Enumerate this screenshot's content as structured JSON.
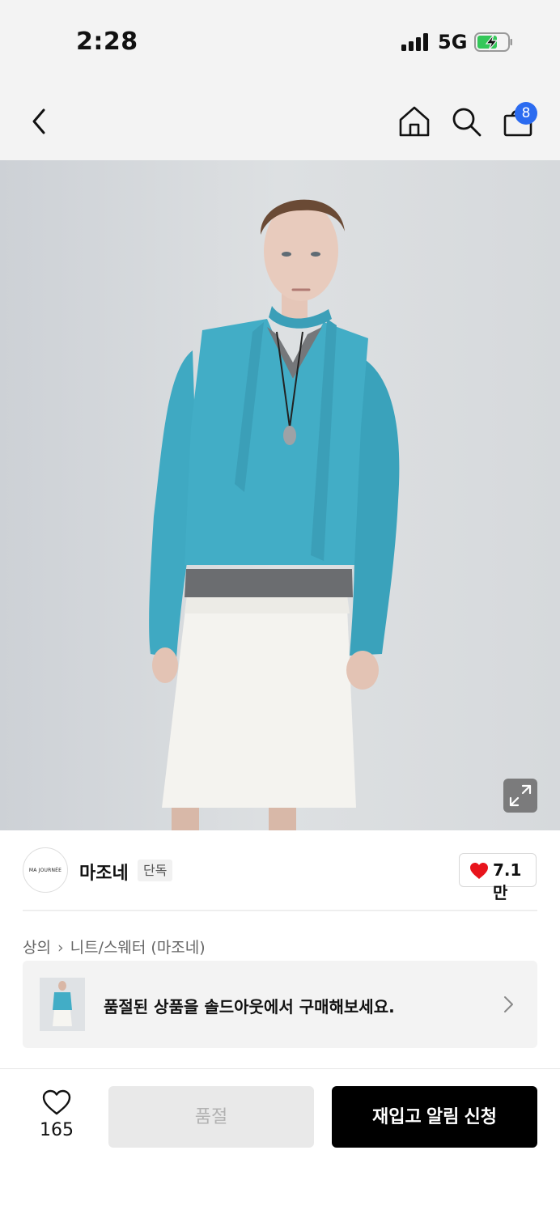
{
  "status_bar": {
    "time": "2:28",
    "network": "5G",
    "signal_icon": "signal-bars-icon",
    "battery_icon": "battery-charging-icon",
    "battery_color": "#34c759"
  },
  "nav": {
    "back_icon": "chevron-left-icon",
    "home_icon": "home-icon",
    "search_icon": "search-icon",
    "cart_icon": "shopping-bag-icon",
    "cart_count": "8",
    "badge_color": "#2b6bf0"
  },
  "product_image": {
    "expand_icon": "expand-icon"
  },
  "brand": {
    "logo_text": "MA JOURNÉE",
    "name": "마조네",
    "tag": "단독",
    "likes": "7.1만",
    "heart_color": "#e8141c"
  },
  "breadcrumb": {
    "items": [
      "상의",
      "니트/스웨터 (마조네)"
    ]
  },
  "soldout_banner": {
    "text": "품절된 상품을 솔드아웃에서 구매해보세요."
  },
  "bottom_bar": {
    "wish_count": "165",
    "soldout_label": "품절",
    "restock_label": "재입고 알림 신청"
  }
}
